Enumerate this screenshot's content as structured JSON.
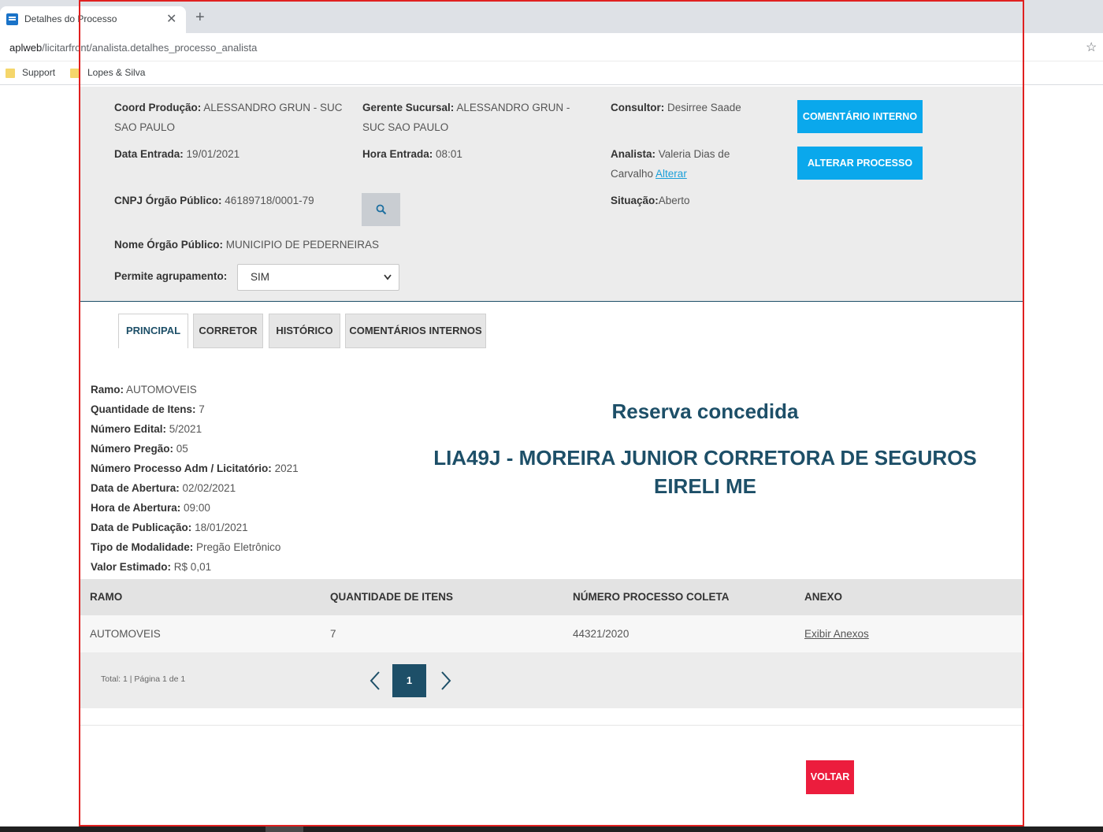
{
  "browser": {
    "tab_title": "Detalhes do Processo",
    "tab_close": "✕",
    "new_tab": "+",
    "url_host": "aplweb",
    "url_path": "/licitarfront/analista.detalhes_processo_analista",
    "bookmarks": [
      "Support",
      "Lopes & Silva"
    ]
  },
  "info": {
    "coord_label": "Coord Produção:",
    "coord_value": "ALESSANDRO GRUN - SUC SAO PAULO",
    "gerente_label": "Gerente Sucursal:",
    "gerente_value": "ALESSANDRO GRUN - SUC SAO PAULO",
    "consultor_label": "Consultor:",
    "consultor_value": "Desirree Saade",
    "data_entrada_label": "Data Entrada:",
    "data_entrada_value": "19/01/2021",
    "hora_entrada_label": "Hora Entrada:",
    "hora_entrada_value": "08:01",
    "analista_label": "Analista:",
    "analista_value": "Valeria Dias de Carvalho",
    "analista_link": "Alterar",
    "cnpj_label": "CNPJ Órgão Público:",
    "cnpj_value": "46189718/0001-79",
    "situacao_label": "Situação:",
    "situacao_value": "Aberto",
    "nome_label": "Nome Órgão Público:",
    "nome_value": "MUNICIPIO DE PEDERNEIRAS",
    "agrupamento_label": "Permite agrupamento:",
    "agrupamento_value": "SIM",
    "btn_comentario": "COMENTÁRIO INTERNO",
    "btn_alterar": "ALTERAR PROCESSO"
  },
  "tabs": [
    "PRINCIPAL",
    "CORRETOR",
    "HISTÓRICO",
    "COMENTÁRIOS INTERNOS"
  ],
  "details": [
    {
      "label": "Ramo:",
      "value": "AUTOMOVEIS"
    },
    {
      "label": "Quantidade de Itens:",
      "value": "7"
    },
    {
      "label": "Número Edital:",
      "value": "5/2021"
    },
    {
      "label": "Número Pregão:",
      "value": "05"
    },
    {
      "label": "Número Processo Adm / Licitatório:",
      "value": "2021"
    },
    {
      "label": "Data de Abertura:",
      "value": "02/02/2021"
    },
    {
      "label": "Hora de Abertura:",
      "value": "09:00"
    },
    {
      "label": "Data de Publicação:",
      "value": "18/01/2021"
    },
    {
      "label": "Tipo de Modalidade:",
      "value": "Pregão Eletrônico"
    },
    {
      "label": "Valor Estimado:",
      "value": "R$ 0,01"
    }
  ],
  "reserve": {
    "title": "Reserva concedida",
    "name": "LIA49J - MOREIRA JUNIOR CORRETORA DE SEGUROS EIRELI ME"
  },
  "table": {
    "headers": [
      "RAMO",
      "QUANTIDADE DE ITENS",
      "NÚMERO PROCESSO COLETA",
      "ANEXO"
    ],
    "rows": [
      [
        "AUTOMOVEIS",
        "7",
        "44321/2020",
        "Exibir Anexos"
      ]
    ]
  },
  "pagination": {
    "summary": "Total: 1 | Página 1 de 1",
    "current": "1"
  },
  "btn_voltar": "VOLTAR",
  "colors": {
    "primary_dark": "#1d4f68",
    "button_blue": "#0aa8ec",
    "button_red": "#ec1d3d"
  }
}
